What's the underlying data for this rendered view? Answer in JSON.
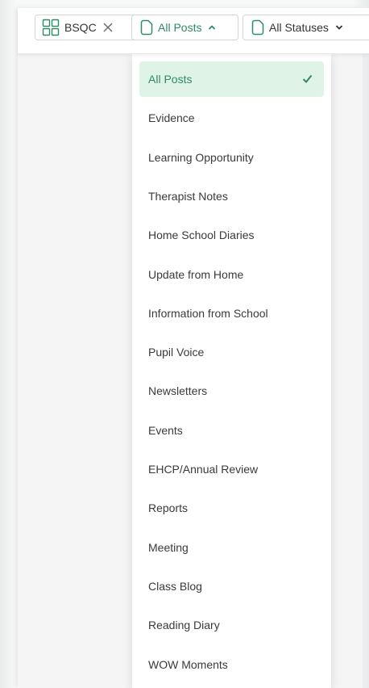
{
  "filters": {
    "school": {
      "label": "BSQC",
      "icon": "grid-icon",
      "trailing_icon": "close-icon"
    },
    "posts": {
      "label": "All Posts",
      "icon": "document-icon",
      "trailing_icon": "chevron-up-icon"
    },
    "status": {
      "label": "All Statuses",
      "icon": "document-icon",
      "trailing_icon": "chevron-down-icon"
    }
  },
  "post_menu": {
    "selected": "All Posts",
    "items": [
      "All Posts",
      "Evidence",
      "Learning Opportunity",
      "Therapist Notes",
      "Home School Diaries",
      "Update from Home",
      "Information from School",
      "Pupil Voice",
      "Newsletters",
      "Events",
      "EHCP/Annual Review",
      "Reports",
      "Meeting",
      "Class Blog",
      "Reading Diary",
      "WOW Moments"
    ]
  },
  "colors": {
    "accent": "#2e8b63",
    "selected_bg": "#dff3e7",
    "text": "#3a3a3a",
    "border": "#cfd6d3"
  }
}
